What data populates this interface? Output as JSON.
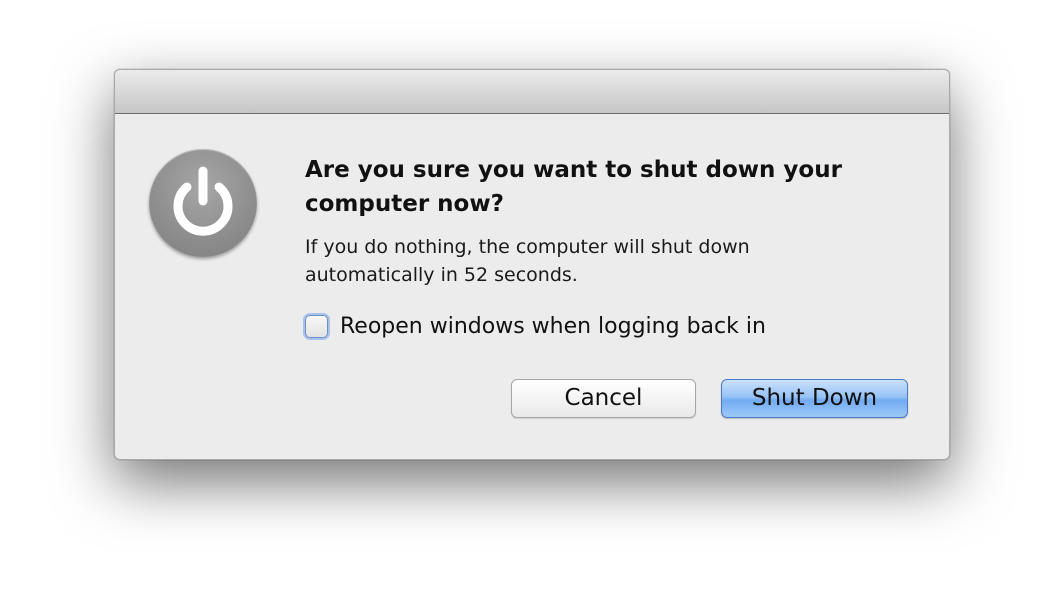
{
  "dialog": {
    "icon": "power-icon",
    "title": "Are you sure you want to shut down your computer now?",
    "message": "If you do nothing, the computer will shut down automatically in 52 seconds.",
    "checkbox": {
      "label": "Reopen windows when logging back in",
      "checked": false
    },
    "buttons": {
      "cancel_label": "Cancel",
      "default_label": "Shut Down"
    }
  },
  "colors": {
    "dialog_background": "#ececec",
    "default_button": "#73abf1",
    "icon_gray": "#8d8d8d"
  }
}
